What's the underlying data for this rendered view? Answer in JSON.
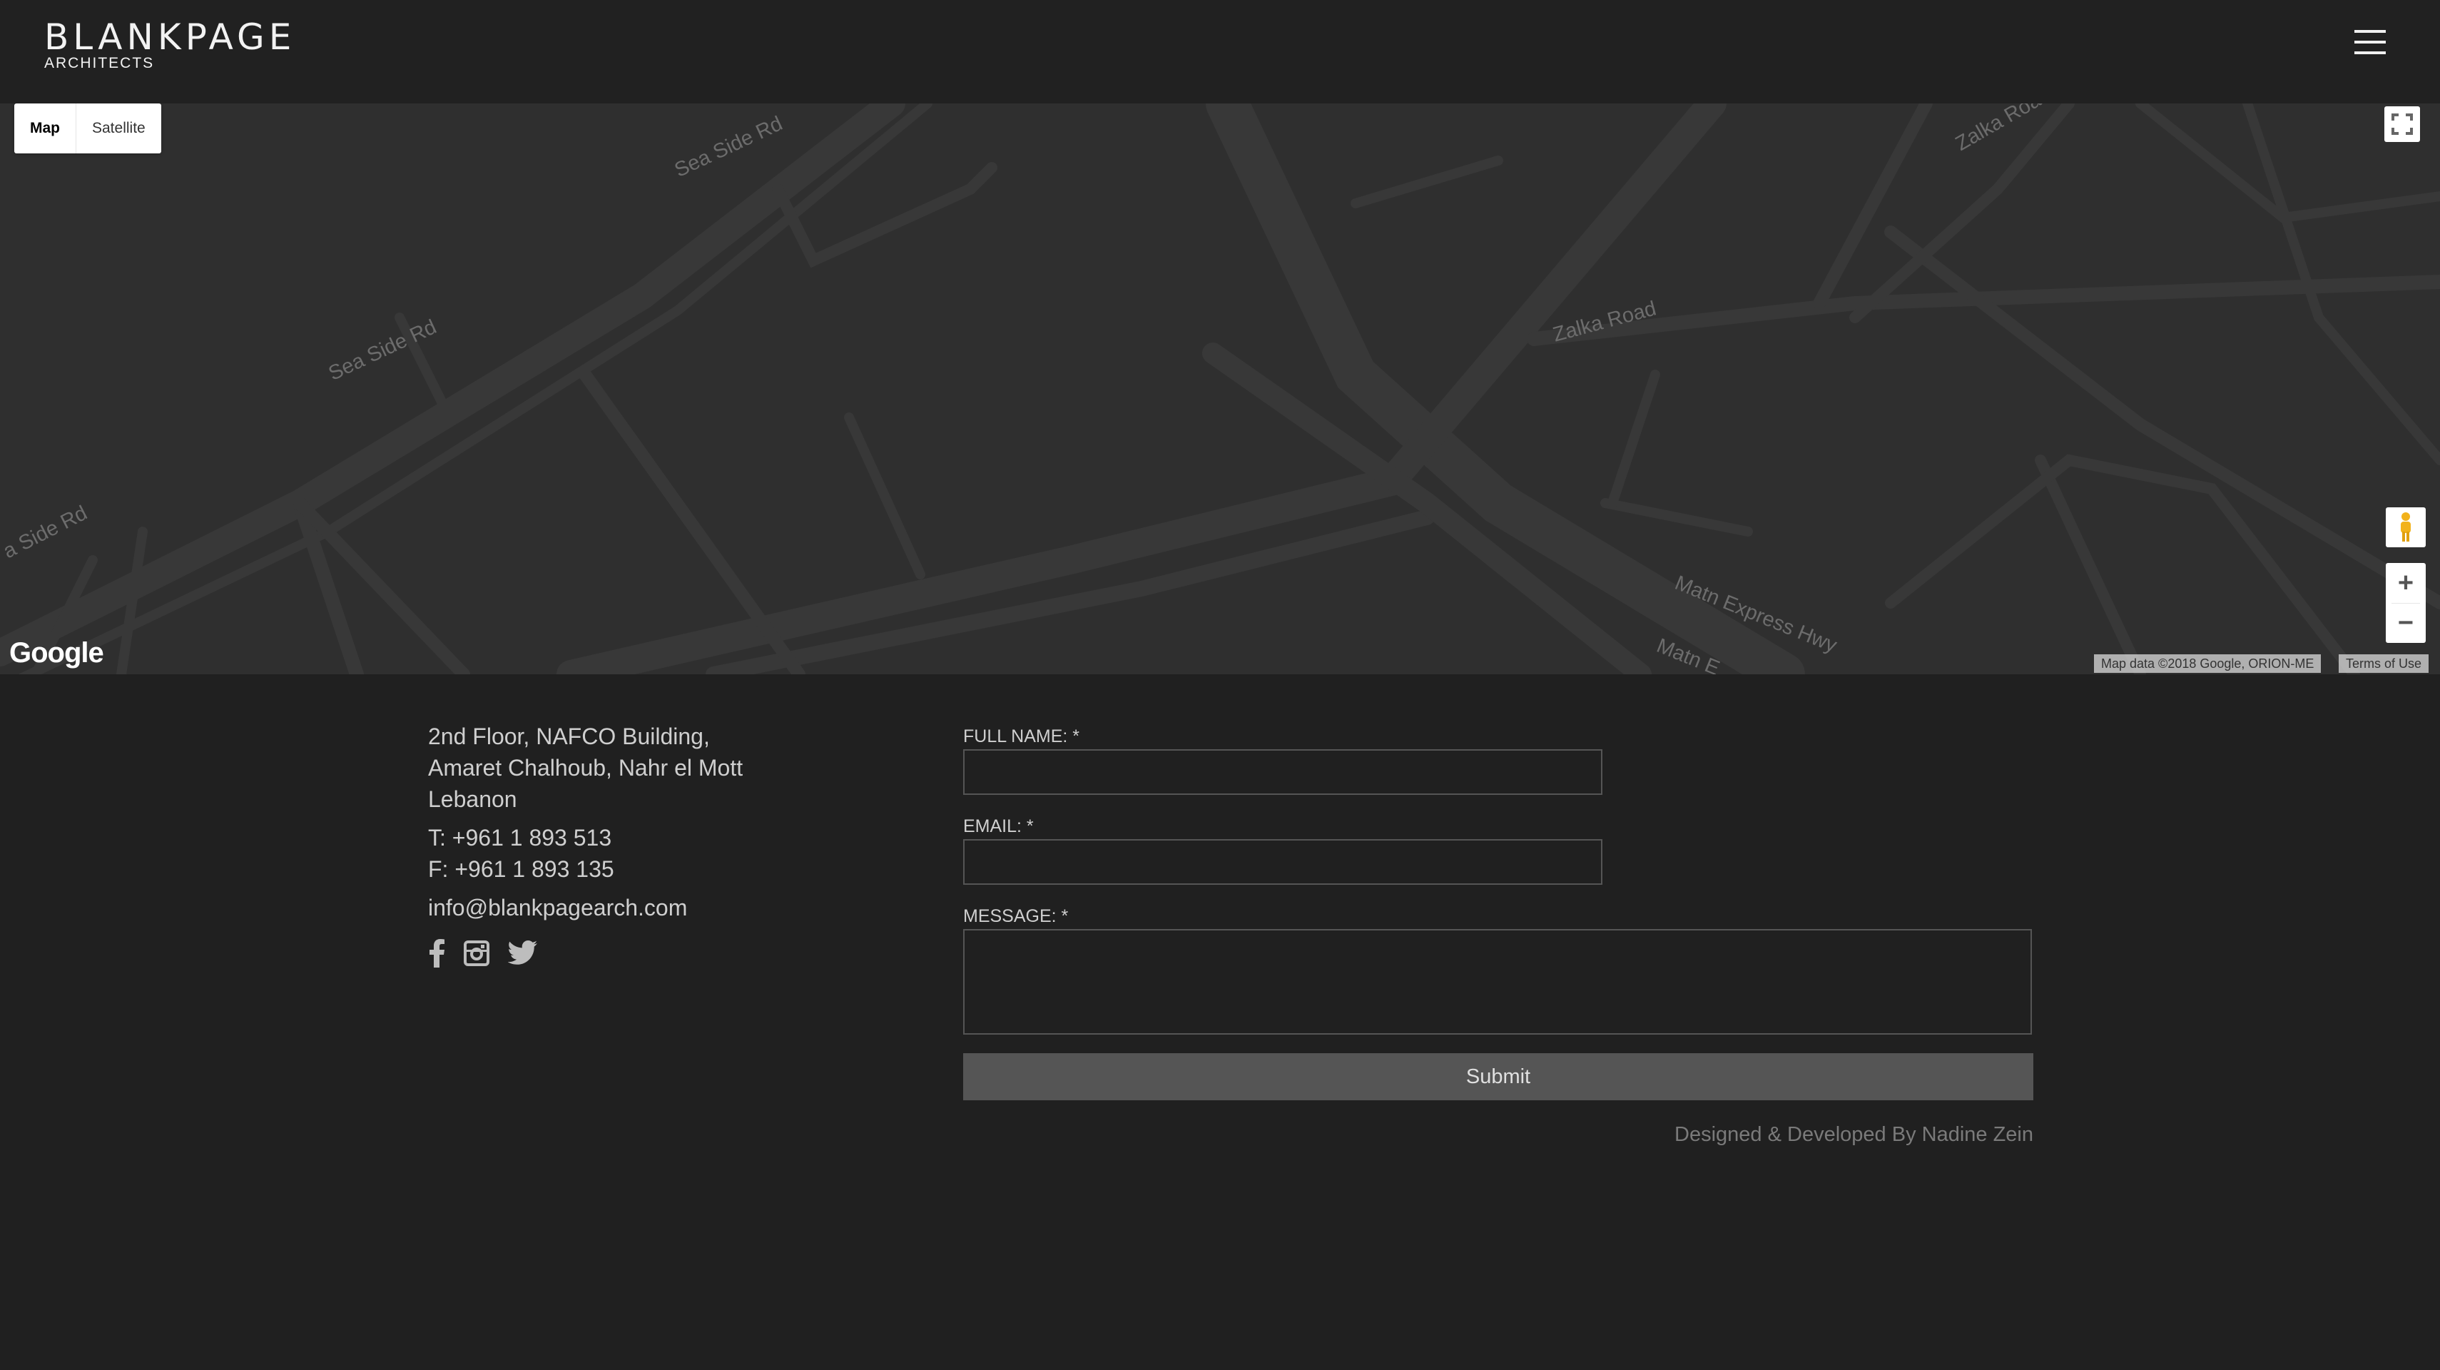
{
  "header": {
    "brand": "BLANKPAGE",
    "brand_sub": "ARCHITECTS",
    "menu_icon": "hamburger-menu-icon"
  },
  "map": {
    "type_controls": [
      "Map",
      "Satellite"
    ],
    "active_type": "Map",
    "road_labels": [
      "Sea Side Rd",
      "Sea Side Rd",
      "a Side Rd",
      "Zalka Road",
      "Zalka Roa",
      "Matn Express Hwy",
      "Matn E"
    ],
    "provider_logo": "Google",
    "attribution": "Map data ©2018 Google, ORION-ME",
    "terms": "Terms of Use",
    "zoom_in": "+",
    "zoom_out": "−"
  },
  "contact": {
    "address_line1": "2nd Floor, NAFCO Building,",
    "address_line2": "Amaret Chalhoub, Nahr el Mott",
    "address_line3": "Lebanon",
    "phone": "T: +961 1 893 513",
    "fax": "F: +961 1 893 135",
    "email": "info@blankpagearch.com",
    "social_icons": [
      "facebook-icon",
      "instagram-icon",
      "twitter-icon"
    ]
  },
  "form": {
    "full_name_label": "FULL NAME: *",
    "full_name_value": "",
    "email_label": "EMAIL: *",
    "email_value": "",
    "message_label": "MESSAGE: *",
    "message_value": "",
    "submit_label": "Submit"
  },
  "footer": {
    "credit": "Designed & Developed By Nadine Zein"
  },
  "colors": {
    "background": "#202020",
    "map_background": "#2f2f2f",
    "road": "#3a3a3a",
    "button": "#555555"
  }
}
